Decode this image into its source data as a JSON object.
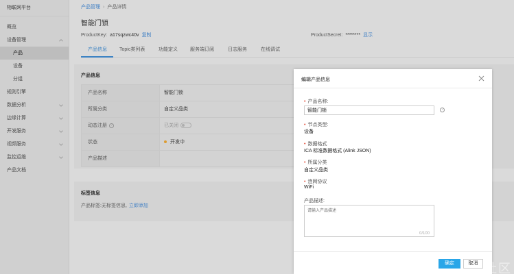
{
  "sidebar": {
    "title": "物联网平台",
    "items": [
      {
        "label": "概览"
      },
      {
        "label": "设备管理"
      },
      {
        "label": "产品"
      },
      {
        "label": "设备"
      },
      {
        "label": "分组"
      },
      {
        "label": "规则引擎"
      },
      {
        "label": "数据分析"
      },
      {
        "label": "边缘计算"
      },
      {
        "label": "开发服务"
      },
      {
        "label": "视频服务"
      },
      {
        "label": "监控运维"
      },
      {
        "label": "产品文档"
      }
    ]
  },
  "breadcrumb": {
    "parent": "产品管理",
    "separator": "›",
    "current": "产品详情"
  },
  "page_title": "智能门锁",
  "meta": {
    "product_key_label": "ProductKey:",
    "product_key_value": "a17sqzwc40v",
    "copy_label": "复制",
    "product_secret_label": "ProductSecret:",
    "product_secret_value": "********",
    "show_label": "显示"
  },
  "tabs": [
    "产品信息",
    "Topic类列表",
    "功能定义",
    "服务端订阅",
    "日志服务",
    "在线调试"
  ],
  "product_info": {
    "title": "产品信息",
    "rows": [
      {
        "label": "产品名称",
        "value": "智能门锁"
      },
      {
        "label": "所属分类",
        "value": "自定义品类"
      },
      {
        "label": "动态注册",
        "value": "已关闭"
      },
      {
        "label": "状态",
        "value": "开发中"
      },
      {
        "label": "产品描述",
        "value": ""
      }
    ],
    "help_glyph": "?"
  },
  "tag_info": {
    "title": "标签信息",
    "tag_label": "产品标签:",
    "tag_value": "无标签信息,",
    "add_link": "立即添加"
  },
  "dialog": {
    "title": "编辑产品信息",
    "name_label": "产品名称:",
    "name_value": "智能门锁",
    "node_type_label": "节点类型:",
    "node_type_value": "设备",
    "data_format_label": "数据格式",
    "data_format_value": "ICA 标准数据格式 (Alink JSON)",
    "category_label": "所属分类",
    "category_value": "自定义品类",
    "network_label": "连网协议",
    "network_value": "WiFi",
    "desc_label": "产品描述:",
    "desc_placeholder": "请输入产品描述",
    "desc_counter": "0/100",
    "ok_label": "确定",
    "cancel_label": "取消"
  },
  "watermark": "社区",
  "colors": {
    "accent": "#2f86d6",
    "ok_button": "#29a6e8",
    "required": "#e0432f",
    "status_dot": "#f5a623"
  }
}
